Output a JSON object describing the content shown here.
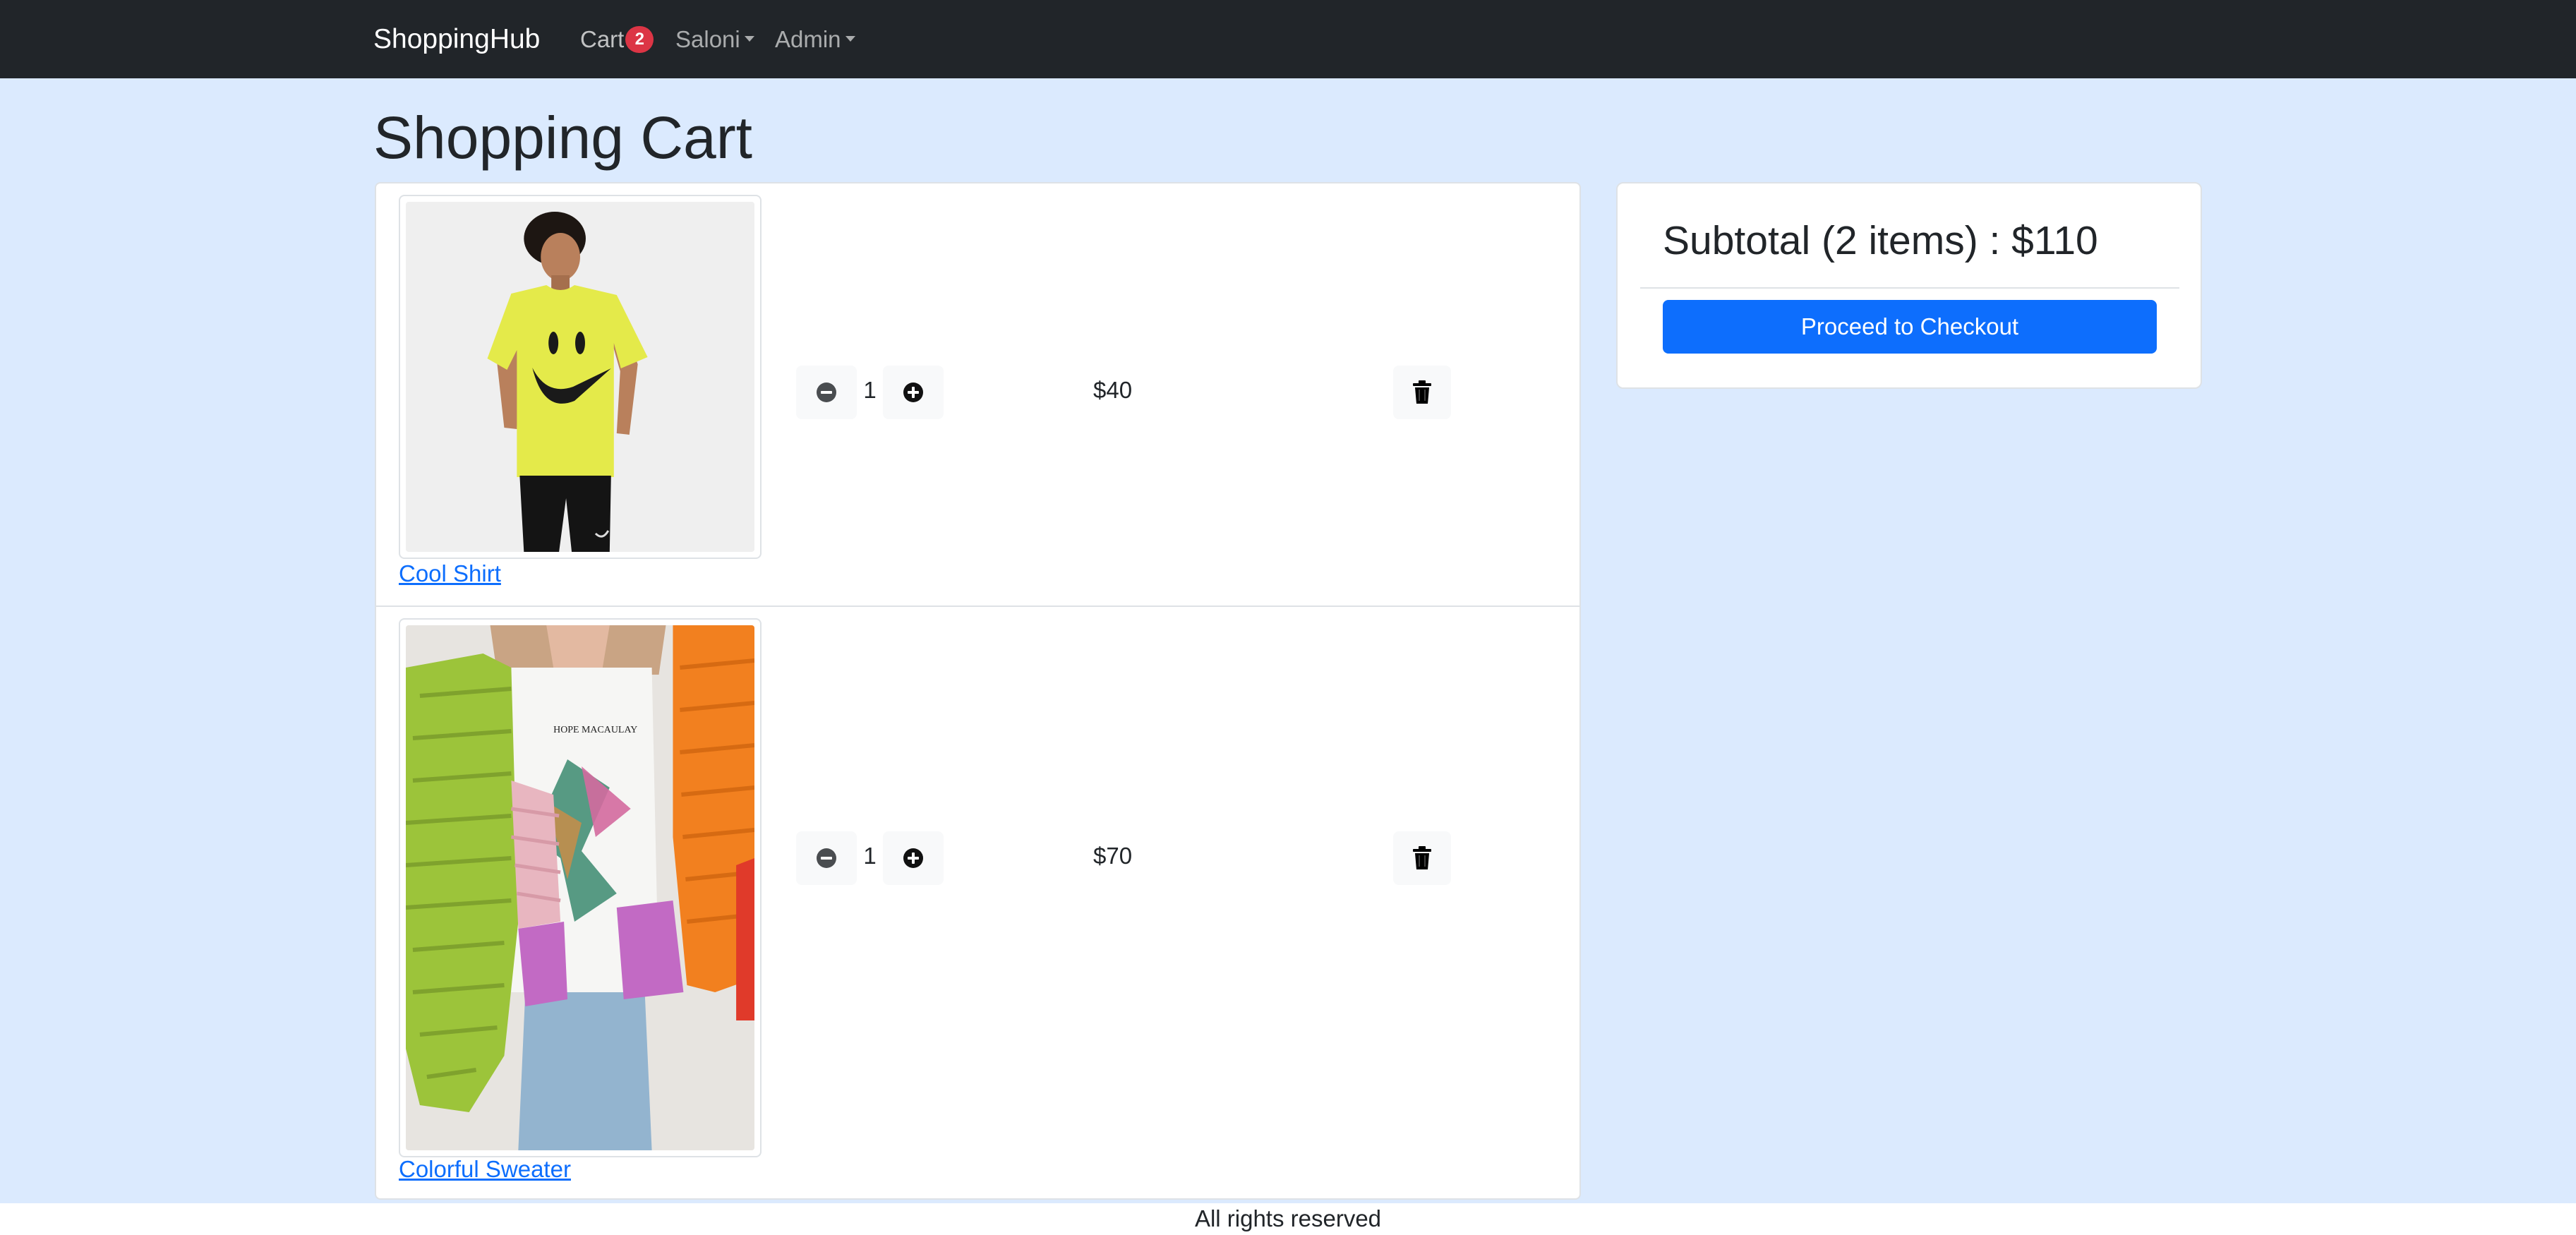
{
  "navbar": {
    "brand": "ShoppingHub",
    "cart_label": "Cart",
    "cart_count": "2",
    "menus": [
      {
        "label": "Saloni"
      },
      {
        "label": "Admin"
      }
    ]
  },
  "page": {
    "title": "Shopping Cart"
  },
  "cart": {
    "items": [
      {
        "name": "Cool Shirt",
        "quantity": "1",
        "price": "$40",
        "image": "yellow smiley t-shirt product photo"
      },
      {
        "name": "Colorful Sweater",
        "quantity": "1",
        "price": "$70",
        "image": "colorful knit cardigan product photo"
      }
    ]
  },
  "summary": {
    "subtotal": "Subtotal (2 items) : $110",
    "checkout_label": "Proceed to Checkout"
  },
  "footer": {
    "text": "All rights reserved"
  },
  "colors": {
    "navbar_bg": "#212529",
    "page_bg": "#dbeafe",
    "badge": "#dc3545",
    "primary": "#0d6efd",
    "link": "#0d6efd"
  },
  "icons": {
    "minus": "dash-circle-fill-icon",
    "plus": "plus-circle-fill-icon",
    "delete": "trash-icon",
    "dropdown": "caret-down-icon"
  }
}
